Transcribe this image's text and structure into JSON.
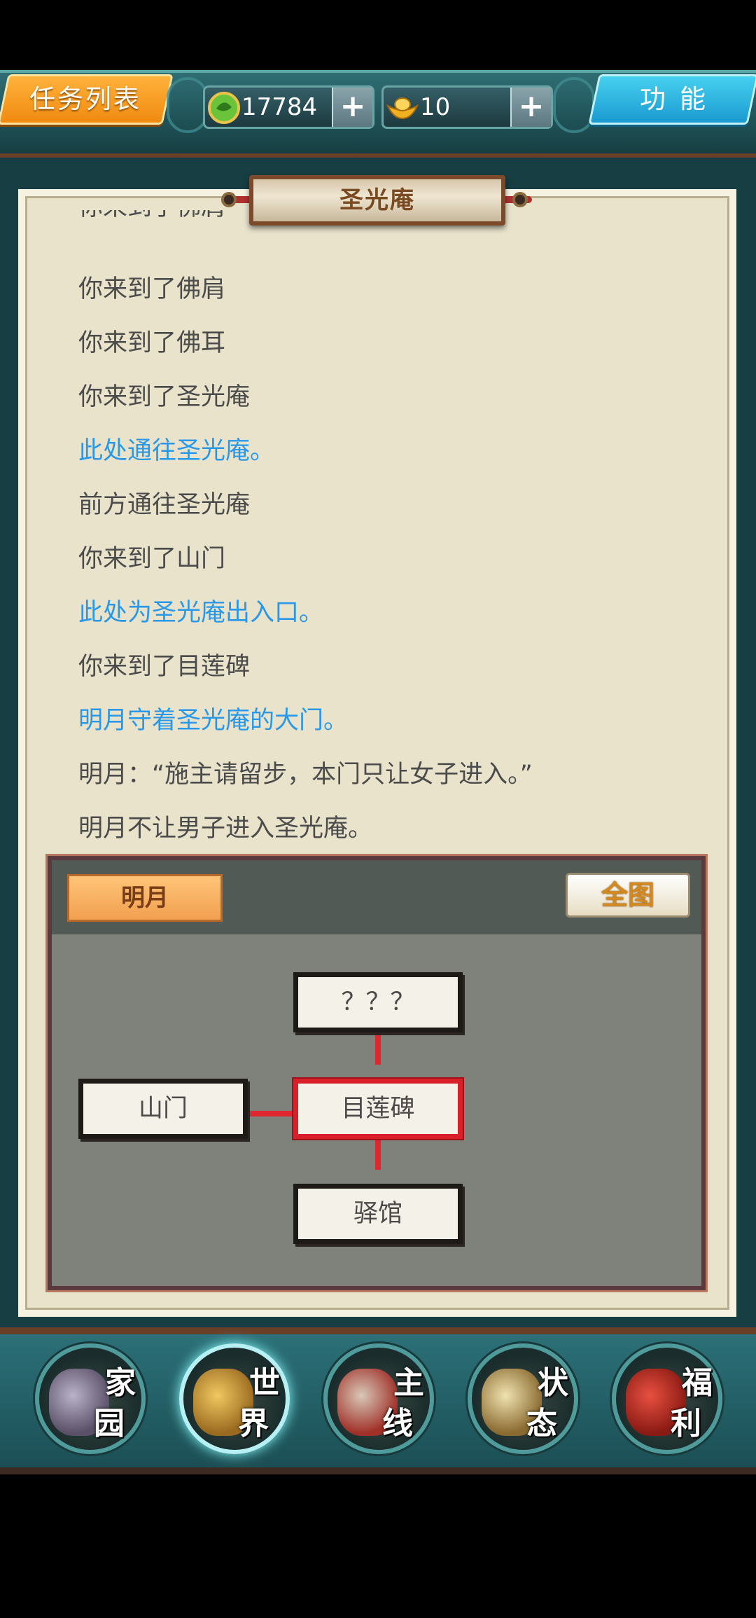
{
  "topbar": {
    "task_list_label": "任务列表",
    "jade_amount": "17784",
    "gold_amount": "10",
    "plus_label": "+",
    "function_label": "功能"
  },
  "location": {
    "title": "圣光庵"
  },
  "messages": [
    {
      "text": "你来到了佛肩",
      "type": "normal"
    },
    {
      "text": "你来到了佛肩",
      "type": "normal"
    },
    {
      "text": "你来到了佛耳",
      "type": "normal"
    },
    {
      "text": "你来到了圣光庵",
      "type": "normal"
    },
    {
      "text": "此处通往圣光庵。",
      "type": "blue"
    },
    {
      "text": "前方通往圣光庵",
      "type": "normal"
    },
    {
      "text": "你来到了山门",
      "type": "normal"
    },
    {
      "text": "此处为圣光庵出入口。",
      "type": "blue"
    },
    {
      "text": "你来到了目莲碑",
      "type": "normal"
    },
    {
      "text": "明月守着圣光庵的大门。",
      "type": "blue"
    },
    {
      "text": "明月：“施主请留步，本门只让女子进入。”",
      "type": "normal"
    },
    {
      "text": "明月不让男子进入圣光庵。",
      "type": "normal"
    }
  ],
  "map": {
    "npc_button": "明月",
    "full_map_button": "全图",
    "nodes": {
      "north": "？？？",
      "west": "山门",
      "current": "目莲碑",
      "south": "驿馆"
    }
  },
  "nav": [
    {
      "c1": "家",
      "c2": "园"
    },
    {
      "c1": "世",
      "c2": "界"
    },
    {
      "c1": "主",
      "c2": "线"
    },
    {
      "c1": "状",
      "c2": "态"
    },
    {
      "c1": "福",
      "c2": "利"
    }
  ],
  "colors": {
    "frame": "#173e43",
    "parchment": "#e9e3cc",
    "text": "#4b4b4b",
    "highlight_text": "#2a98e8",
    "current_node": "#d8202a",
    "task_button": "#f08a10",
    "function_button": "#1a9ad0"
  }
}
